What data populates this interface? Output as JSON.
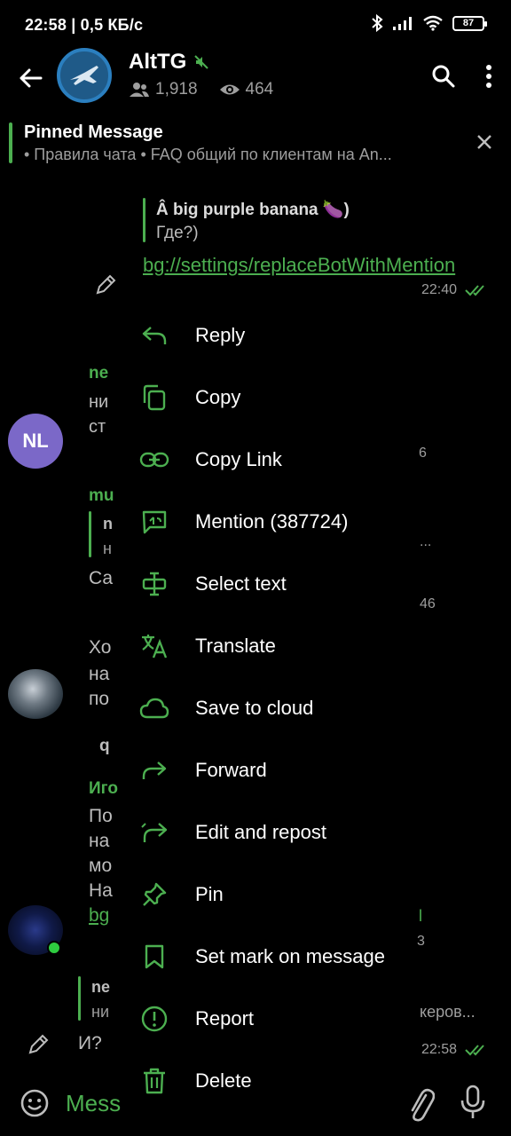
{
  "status": {
    "time_speed": "22:58 | 0,5 КБ/с",
    "battery": "87"
  },
  "header": {
    "title": "AltTG",
    "members": "1,918",
    "online": "464"
  },
  "pinned": {
    "title": "Pinned Message",
    "text": "• Правила чата  • FAQ общий по клиентам на An..."
  },
  "chat": {
    "quoted_name": "Â big purple banana 🍆)",
    "quoted_text": "Где?)",
    "link": "bg://settings/replaceBotWithMention",
    "link_time": "22:40",
    "avatar_nl": "NL",
    "name_ne": "ne",
    "text_ni": "ни",
    "text_st": "ст",
    "num_6": "6",
    "name_mu": "mu",
    "reply_n": "n",
    "reply_n2": "н",
    "ellipsis": "...",
    "text_ca": "Са",
    "num_46": "46",
    "text_xo": "Хо",
    "text_na": "на",
    "text_po": "по",
    "text_q": "q",
    "name_igo": "Иго",
    "text_po2": "По",
    "text_na2": "на",
    "text_mo": "мо",
    "text_Na": "На",
    "text_bg": "bg",
    "num_3": "3",
    "reply_name": "ne",
    "reply_text": "ни",
    "reply_tail": "керов...",
    "last_text": "И?",
    "last_time": "22:58",
    "mark_l": "l"
  },
  "menu": {
    "items": [
      {
        "label": "Reply",
        "icon": "reply-icon"
      },
      {
        "label": "Copy",
        "icon": "copy-icon"
      },
      {
        "label": "Copy Link",
        "icon": "link-icon"
      },
      {
        "label": "Mention (387724)",
        "icon": "mention-icon"
      },
      {
        "label": "Select text",
        "icon": "select-text-icon"
      },
      {
        "label": "Translate",
        "icon": "translate-icon"
      },
      {
        "label": "Save to cloud",
        "icon": "cloud-icon"
      },
      {
        "label": "Forward",
        "icon": "forward-icon"
      },
      {
        "label": "Edit and repost",
        "icon": "edit-repost-icon"
      },
      {
        "label": "Pin",
        "icon": "pin-icon"
      },
      {
        "label": "Set mark on message",
        "icon": "bookmark-icon"
      },
      {
        "label": "Report",
        "icon": "report-icon"
      },
      {
        "label": "Delete",
        "icon": "delete-icon"
      }
    ]
  },
  "input": {
    "placeholder": "Mess"
  },
  "colors": {
    "accent": "#4caf50",
    "background": "#000000",
    "text": "#ffffff",
    "muted": "#9e9e9e"
  }
}
